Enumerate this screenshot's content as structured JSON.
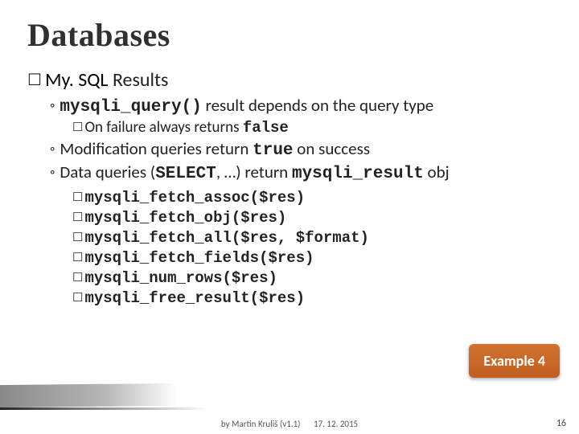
{
  "title": "Databases",
  "section": {
    "subject": "My. SQL",
    "topic": "Results"
  },
  "bullets": {
    "b1_code": "mysqli_query()",
    "b1_text": " result depends on the query type",
    "b1_sub_pre": "On failure always returns ",
    "b1_sub_code": "false",
    "b2_pre": "Modification queries return ",
    "b2_code": "true",
    "b2_post": " on success",
    "b3_pre": "Data queries (",
    "b3_code1": "SELECT",
    "b3_mid": ", …) return ",
    "b3_code2": "mysqli_result",
    "b3_post": " obj"
  },
  "functions": [
    "mysqli_fetch_assoc($res)",
    "mysqli_fetch_obj($res)",
    "mysqli_fetch_all($res, $format)",
    "mysqli_fetch_fields($res)",
    "mysqli_num_rows($res)",
    "mysqli_free_result($res)"
  ],
  "example_label": "Example 4",
  "footer": {
    "author": "by Martin Kruliš (v1.1)",
    "date": "17. 12. 2015"
  },
  "page": "16",
  "glyphs": {
    "checkbox": "☐",
    "diamond": "◦"
  }
}
